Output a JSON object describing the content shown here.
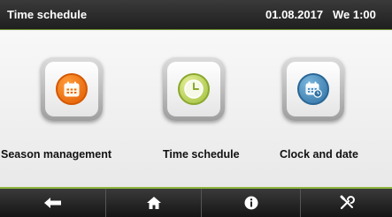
{
  "header": {
    "title": "Time schedule",
    "date": "01.08.2017",
    "day_time": "We 1:00"
  },
  "menu": {
    "items": [
      {
        "label": "Season management",
        "icon": "season-calendar-icon",
        "color": "#f07a10"
      },
      {
        "label": "Time schedule",
        "icon": "clock-icon",
        "color": "#b9d25a"
      },
      {
        "label": "Clock and date",
        "icon": "calendar-clock-icon",
        "color": "#3f86bd"
      }
    ]
  },
  "footer": {
    "buttons": [
      {
        "icon": "back-arrow-icon"
      },
      {
        "icon": "home-icon"
      },
      {
        "icon": "info-icon"
      },
      {
        "icon": "tools-icon"
      }
    ]
  },
  "colors": {
    "accent_line": "#8db33c",
    "bar_background": "#2a2a2a"
  }
}
